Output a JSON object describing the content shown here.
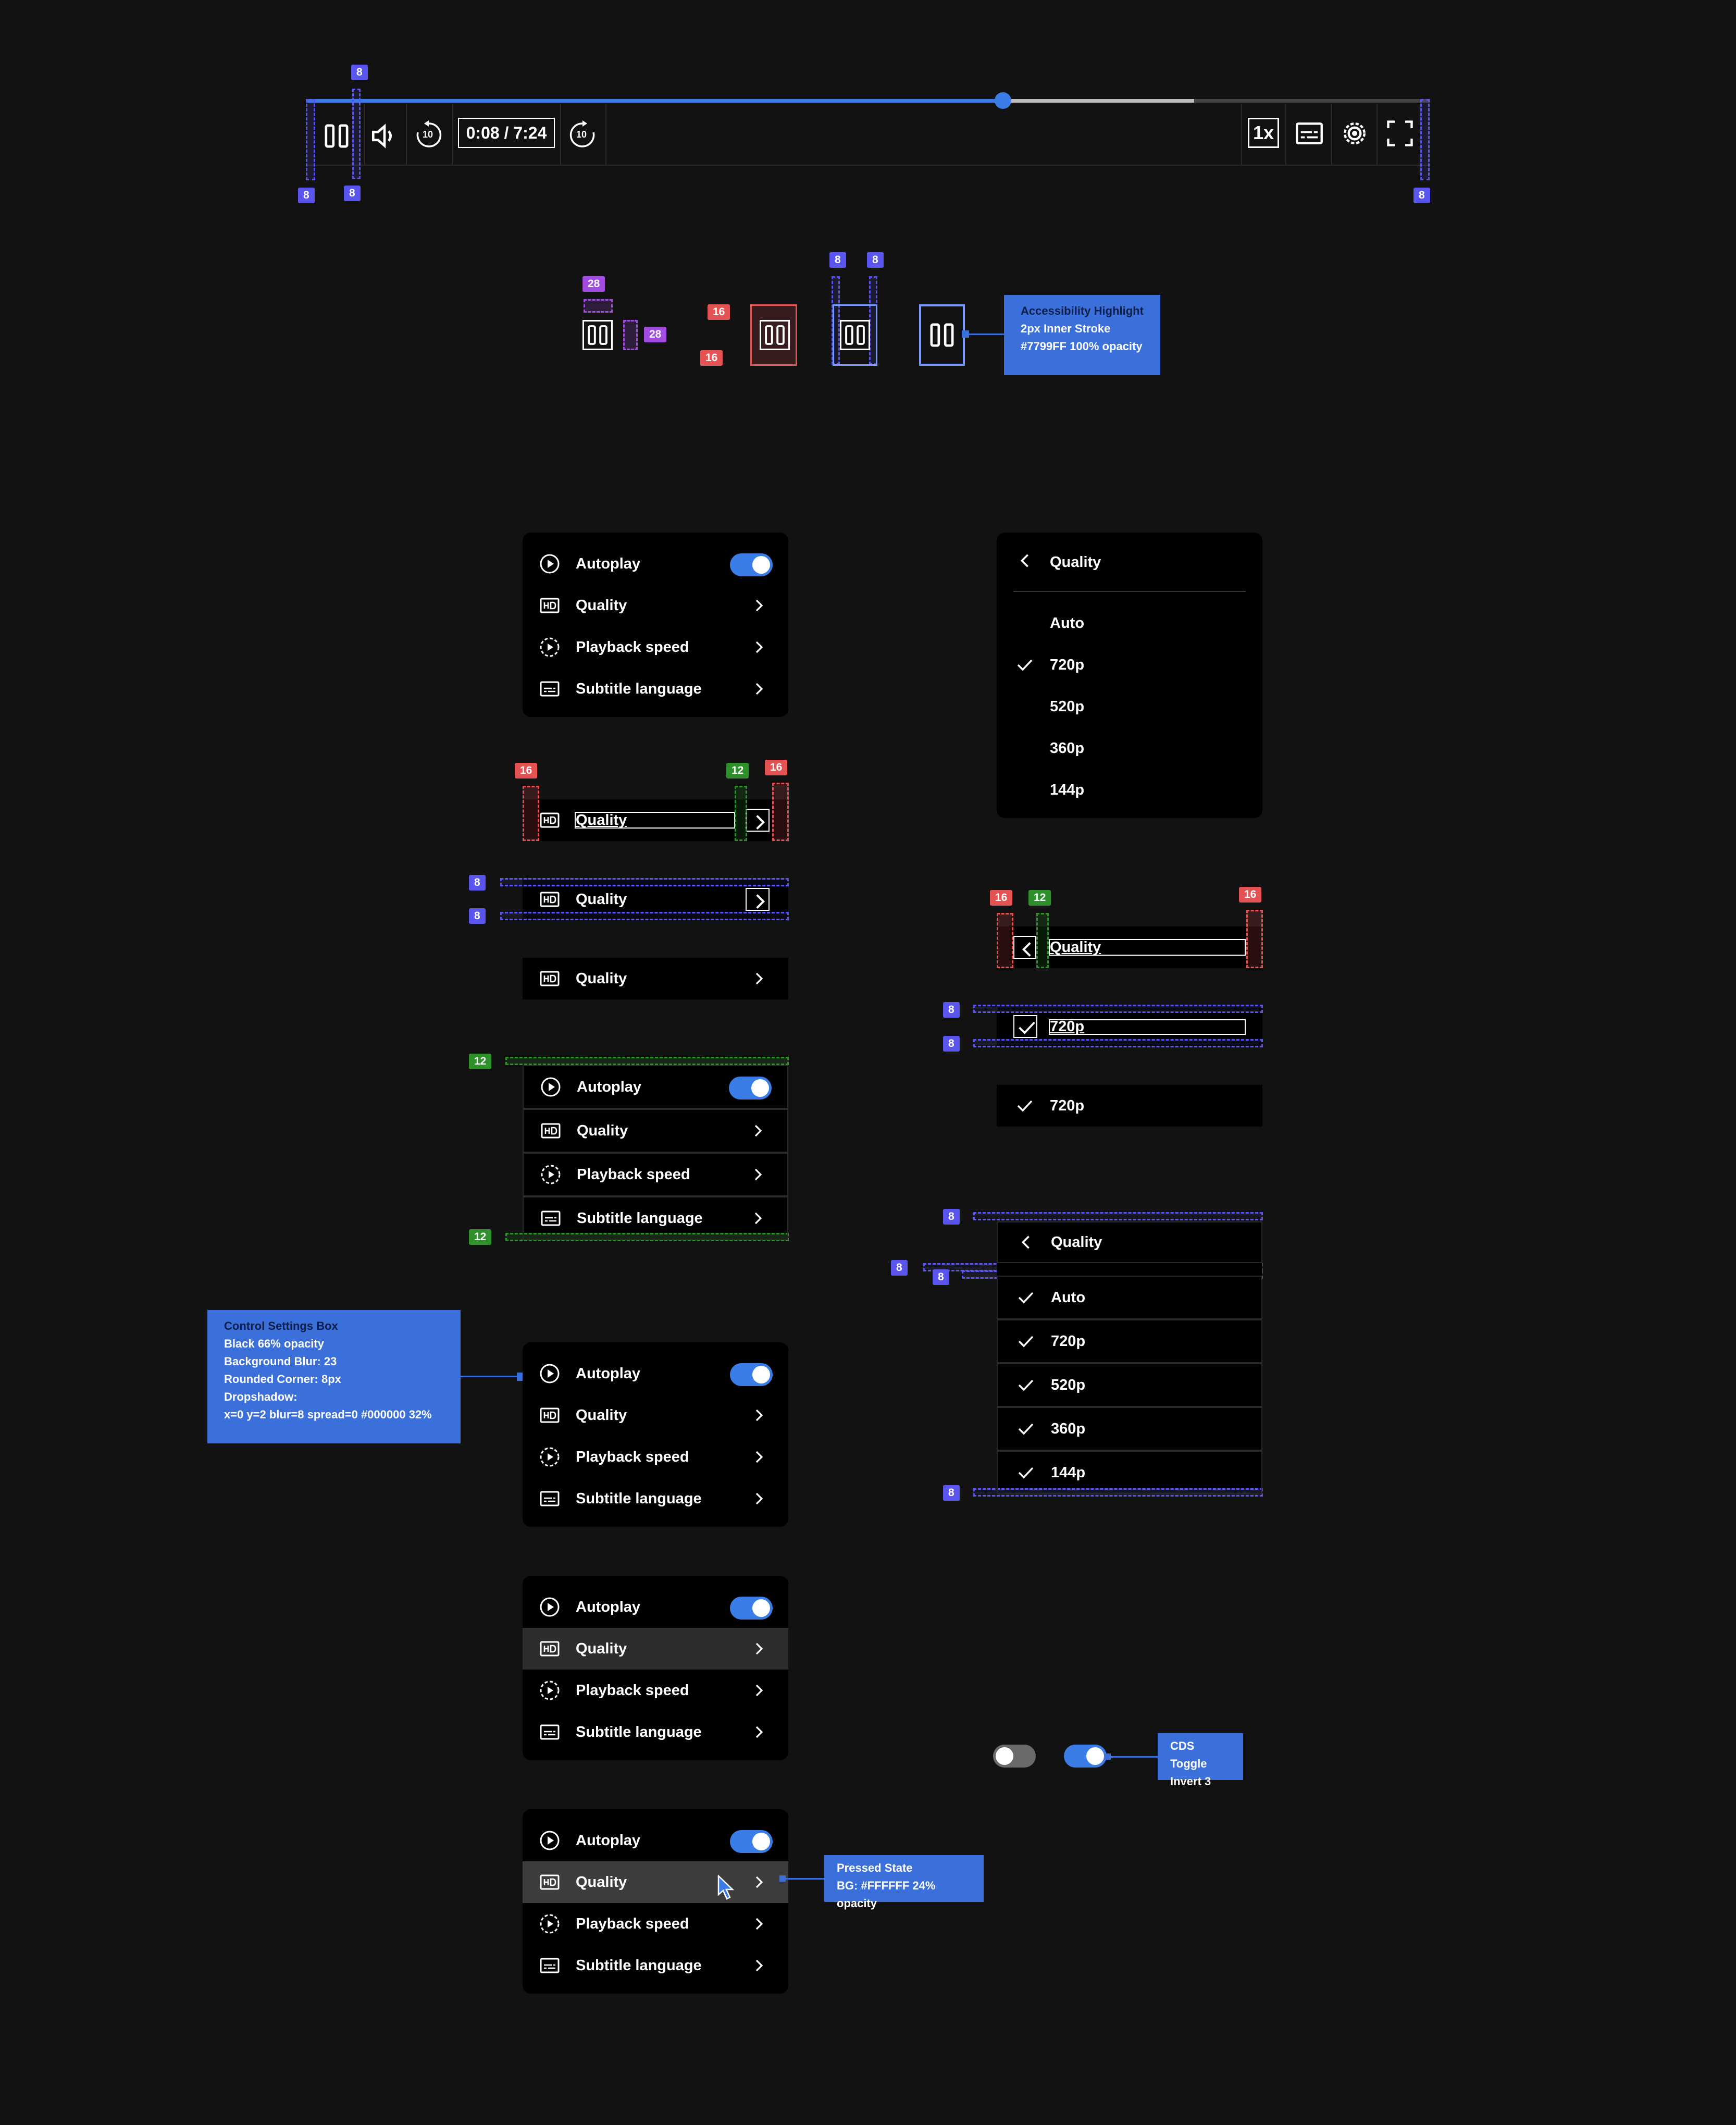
{
  "player": {
    "progress_fraction": 0.62,
    "buffer_fraction": 0.79,
    "time_current": "0:08",
    "time_sep": "/",
    "time_total": "7:24",
    "speed_label": "1x",
    "skip_back_label": "10",
    "skip_fwd_label": "10"
  },
  "badges": {
    "b8": "8",
    "b12": "12",
    "b16": "16",
    "b28": "28"
  },
  "notes": {
    "accessibility": {
      "title": "Accessibility Highlight",
      "line1": "2px Inner Stroke",
      "line2": "#7799FF 100% opacity"
    },
    "settings_box": {
      "title": "Control Settings Box",
      "line1": "Black 66% opacity",
      "line2": "Background Blur: 23",
      "line3": "Rounded Corner: 8px",
      "line4": "Dropshadow:",
      "line5": "x=0  y=2  blur=8  spread=0  #000000 32%"
    },
    "toggle": {
      "title": "CDS Toggle",
      "line1": "Invert 3"
    },
    "pressed": {
      "title": "Pressed State",
      "line1": "BG: #FFFFFF 24% opacity"
    }
  },
  "settings_menu": {
    "autoplay": "Autoplay",
    "quality": "Quality",
    "playback_speed": "Playback speed",
    "subtitle_language": "Subtitle language"
  },
  "quality_menu": {
    "title": "Quality",
    "options": [
      "Auto",
      "720p",
      "520p",
      "360p",
      "144p"
    ],
    "selected": "720p"
  },
  "colors": {
    "accent": "#3a7de6",
    "note": "#3b6fd9",
    "spacing_blue": "#5b55f0",
    "spacing_red": "#e35353",
    "spacing_green": "#2f8f2a",
    "spacing_purple": "#a24be0",
    "focus": "#7799ff"
  }
}
